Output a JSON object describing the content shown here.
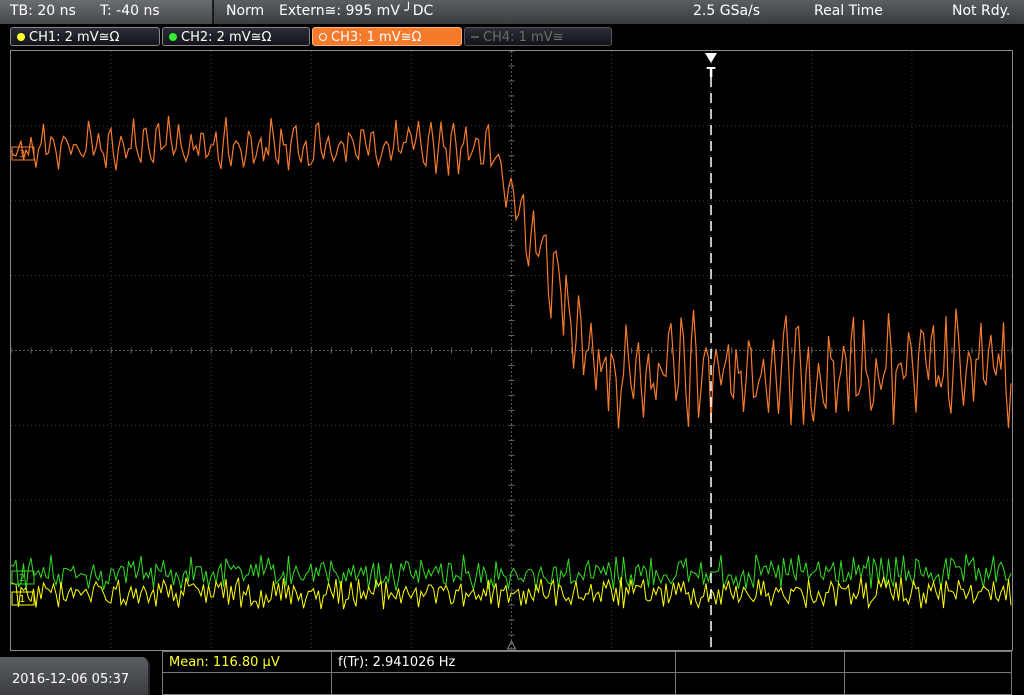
{
  "status_bar": {
    "timebase": "TB: 20 ns",
    "trigger_offset": "T: -40 ns",
    "trigger_mode": "Norm",
    "trigger_source": "Extern≅: 995 mV ╯DC",
    "sample_rate": "2.5 GSa/s",
    "acquisition_mode": "Real Time",
    "status": "Not Rdy."
  },
  "channels": [
    {
      "label": "CH1: 2 mV≅Ω",
      "color": "#ffff33",
      "state": "on"
    },
    {
      "label": "CH2: 2 mV≅Ω",
      "color": "#33ee33",
      "state": "on"
    },
    {
      "label": "CH3: 1 mV≅Ω",
      "color": "#f47a2c",
      "state": "selected"
    },
    {
      "label": "CH4: 1 mV≅",
      "color": "#666666",
      "state": "off"
    }
  ],
  "trigger_marker": "T",
  "waveforms": {
    "ch1": {
      "color": "#ffff00",
      "ref_marker": "1"
    },
    "ch2": {
      "color": "#33dd22",
      "ref_marker": "2"
    },
    "ch3": {
      "color": "#f47a2c",
      "ref_marker": "3"
    }
  },
  "footer": {
    "datetime": "2016-12-06 05:37",
    "measurements": [
      {
        "label": "Mean: 116.80 µV",
        "color": "#ffff33"
      },
      {
        "label": "f(Tr): 2.941026 Hz",
        "color": "#ffffff"
      }
    ]
  }
}
